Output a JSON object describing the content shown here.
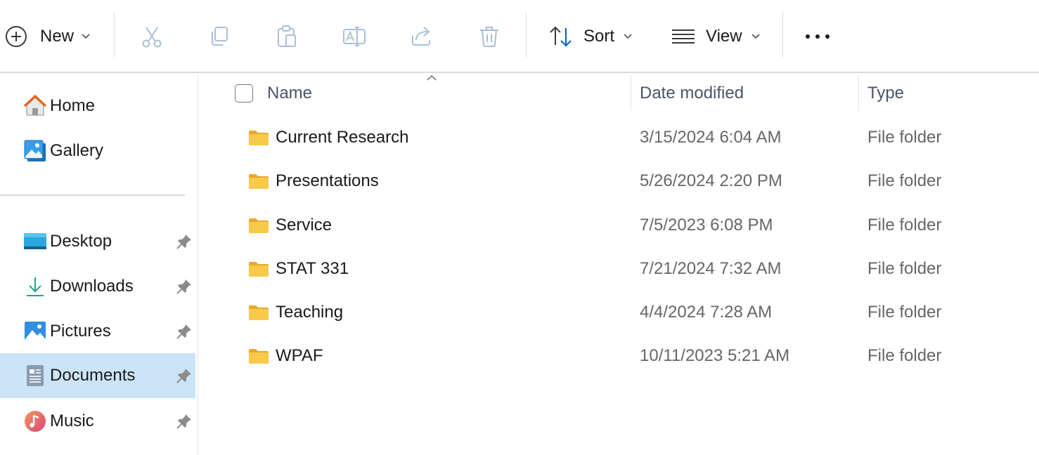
{
  "toolbar": {
    "new_label": "New",
    "sort_label": "Sort",
    "view_label": "View",
    "buttons": [
      "plus-circle-icon",
      "cut-icon",
      "copy-icon",
      "paste-icon",
      "rename-icon",
      "share-icon",
      "delete-icon",
      "sort-icon",
      "view-icon",
      "more-icon"
    ]
  },
  "sidebar": {
    "items": [
      {
        "label": "Home",
        "icon": "home-icon",
        "pinned": false
      },
      {
        "label": "Gallery",
        "icon": "gallery-icon",
        "pinned": false
      },
      {
        "label": "Desktop",
        "icon": "desktop-icon",
        "pinned": true
      },
      {
        "label": "Downloads",
        "icon": "download-icon",
        "pinned": true
      },
      {
        "label": "Pictures",
        "icon": "pictures-icon",
        "pinned": true
      },
      {
        "label": "Documents",
        "icon": "documents-icon",
        "pinned": true,
        "selected": true
      },
      {
        "label": "Music",
        "icon": "music-icon",
        "pinned": true
      }
    ]
  },
  "columns": {
    "name": "Name",
    "date": "Date modified",
    "type": "Type"
  },
  "files": [
    {
      "name": "Current Research",
      "date": "3/15/2024 6:04 AM",
      "type": "File folder"
    },
    {
      "name": "Presentations",
      "date": "5/26/2024 2:20 PM",
      "type": "File folder"
    },
    {
      "name": "Service",
      "date": "7/5/2023 6:08 PM",
      "type": "File folder"
    },
    {
      "name": "STAT 331",
      "date": "7/21/2024 7:32 AM",
      "type": "File folder"
    },
    {
      "name": "Teaching",
      "date": "4/4/2024 7:28 AM",
      "type": "File folder"
    },
    {
      "name": "WPAF",
      "date": "10/11/2023 5:21 AM",
      "type": "File folder"
    }
  ],
  "colors": {
    "accent": "#005fb8",
    "selected_bg": "#cce4f7",
    "folder": "#f8c94a",
    "disabled_icon": "#a9bfd6"
  }
}
